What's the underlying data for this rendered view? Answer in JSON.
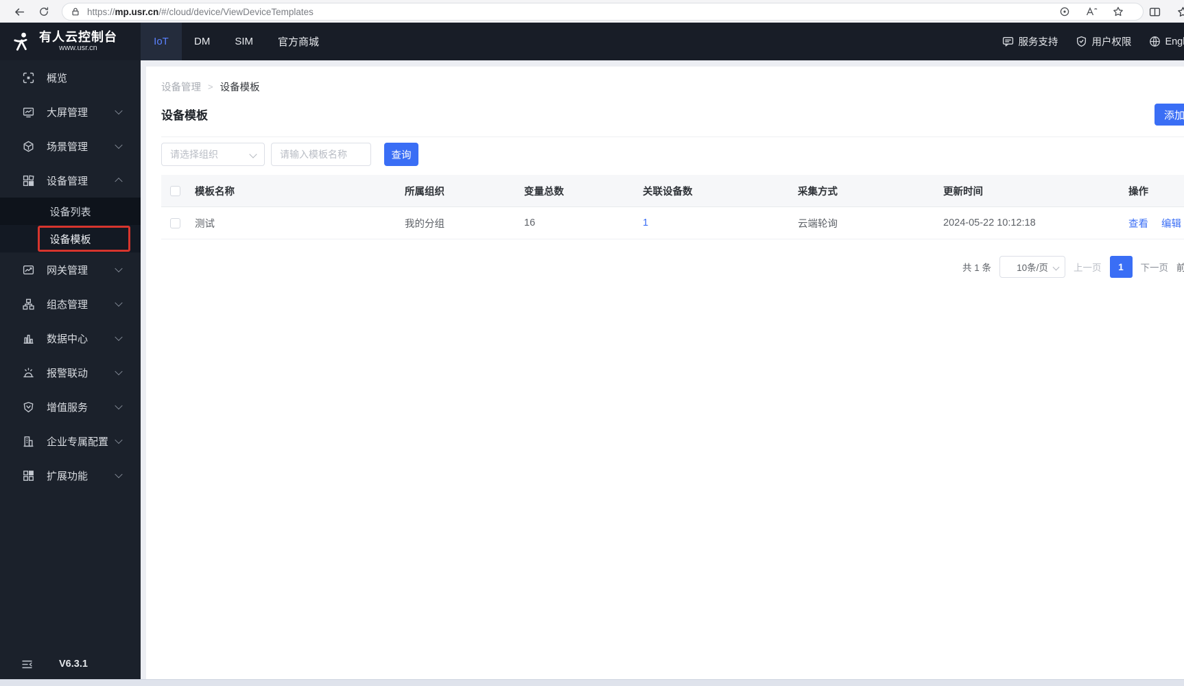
{
  "browser": {
    "url_prefix": "https://",
    "url_domain": "mp.usr.cn",
    "url_path": "/#/cloud/device/ViewDeviceTemplates"
  },
  "header": {
    "logo_title": "有人云控制台",
    "logo_subtitle": "www.usr.cn",
    "tabs": [
      {
        "label": "IoT"
      },
      {
        "label": "DM"
      },
      {
        "label": "SIM"
      },
      {
        "label": "官方商城"
      }
    ],
    "support_label": "服务支持",
    "permission_label": "用户权限",
    "language_label": "English"
  },
  "sidebar": {
    "items": [
      {
        "label": "概览"
      },
      {
        "label": "大屏管理"
      },
      {
        "label": "场景管理"
      },
      {
        "label": "设备管理",
        "children": [
          {
            "label": "设备列表"
          },
          {
            "label": "设备模板"
          }
        ]
      },
      {
        "label": "网关管理"
      },
      {
        "label": "组态管理"
      },
      {
        "label": "数据中心"
      },
      {
        "label": "报警联动"
      },
      {
        "label": "增值服务"
      },
      {
        "label": "企业专属配置"
      },
      {
        "label": "扩展功能"
      }
    ],
    "version": "V6.3.1"
  },
  "main": {
    "breadcrumb": {
      "parent": "设备管理",
      "current": "设备模板"
    },
    "title": "设备模板",
    "add_button_label": "添加",
    "filters": {
      "org_placeholder": "请选择组织",
      "template_placeholder": "请输入模板名称",
      "search_button_label": "查询"
    },
    "table": {
      "headers": [
        "模板名称",
        "所属组织",
        "变量总数",
        "关联设备数",
        "采集方式",
        "更新时间",
        "操作"
      ],
      "rows": [
        {
          "name": "测试",
          "org": "我的分组",
          "variable_count": "16",
          "device_count": "1",
          "collect_mode": "云端轮询",
          "updated_at": "2024-05-22 10:12:18",
          "action_view": "查看",
          "action_edit": "编辑"
        }
      ]
    },
    "pagination": {
      "total": "共 1 条",
      "page_size": "10条/页",
      "prev": "上一页",
      "current_page": "1",
      "next": "下一页",
      "jump": "前"
    }
  },
  "colors": {
    "accent_blue": "#3a6ef5",
    "annotation_red": "#d7352d",
    "nav_dark": "#181d27",
    "sidebar_dark": "#1b212b"
  }
}
